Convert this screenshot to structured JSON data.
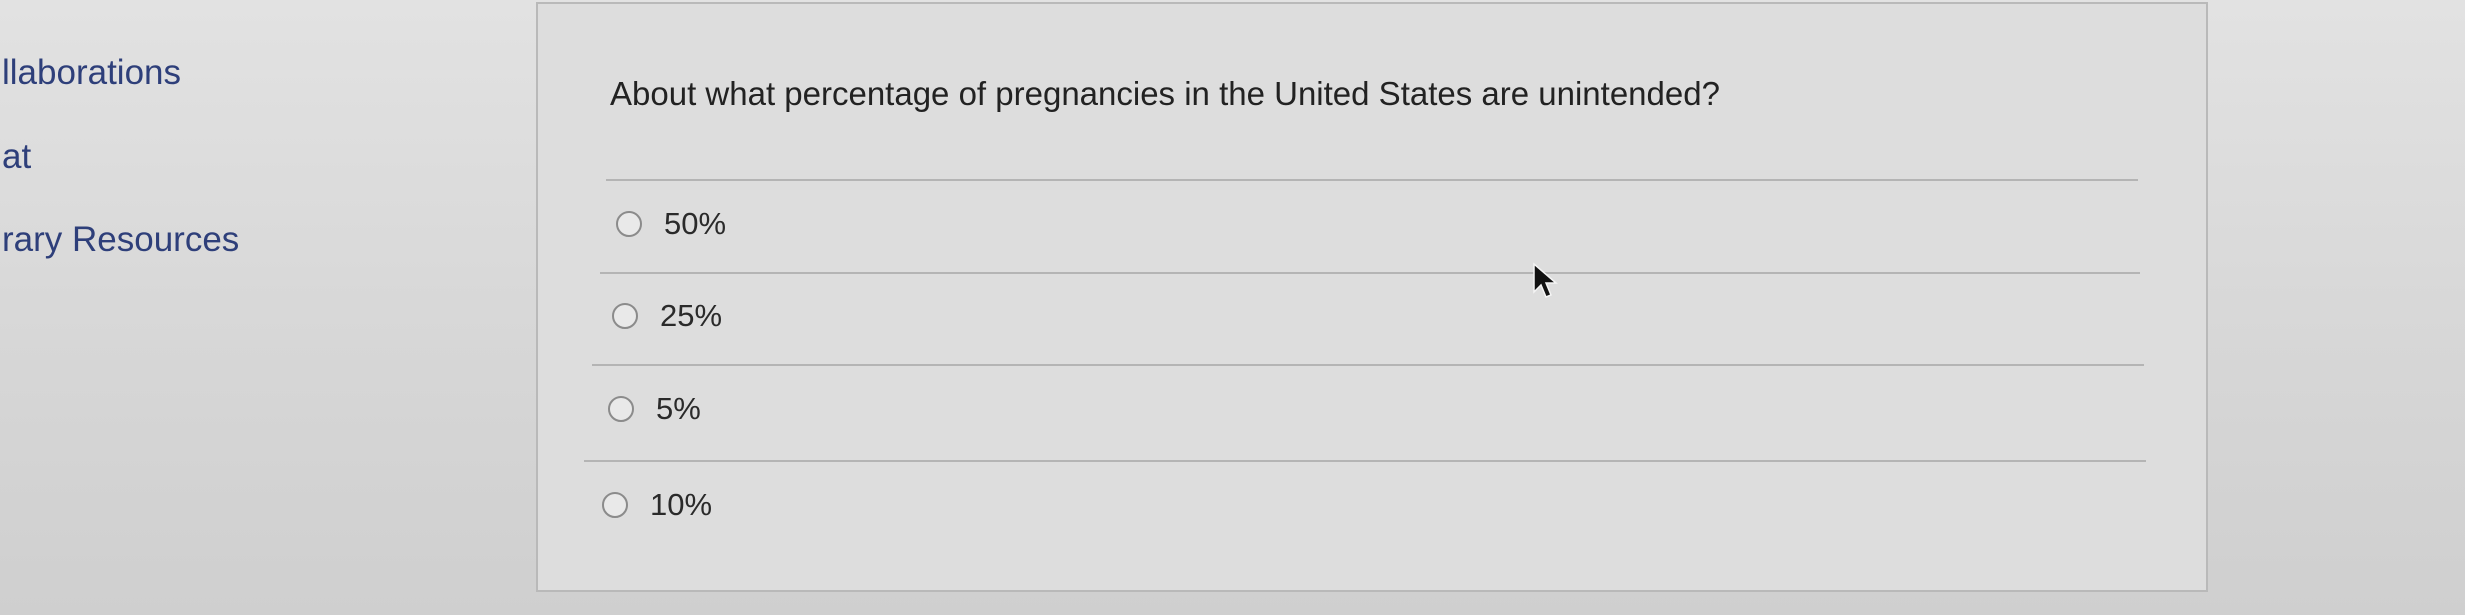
{
  "sidebar": {
    "items": [
      {
        "label": "llaborations"
      },
      {
        "label": "at"
      },
      {
        "label": "rary Resources"
      }
    ]
  },
  "question": {
    "text": "About what percentage of pregnancies in the United States are unintended?",
    "options": [
      {
        "label": "50%",
        "selected": false
      },
      {
        "label": "25%",
        "selected": false
      },
      {
        "label": "5%",
        "selected": false
      },
      {
        "label": "10%",
        "selected": false
      }
    ]
  }
}
